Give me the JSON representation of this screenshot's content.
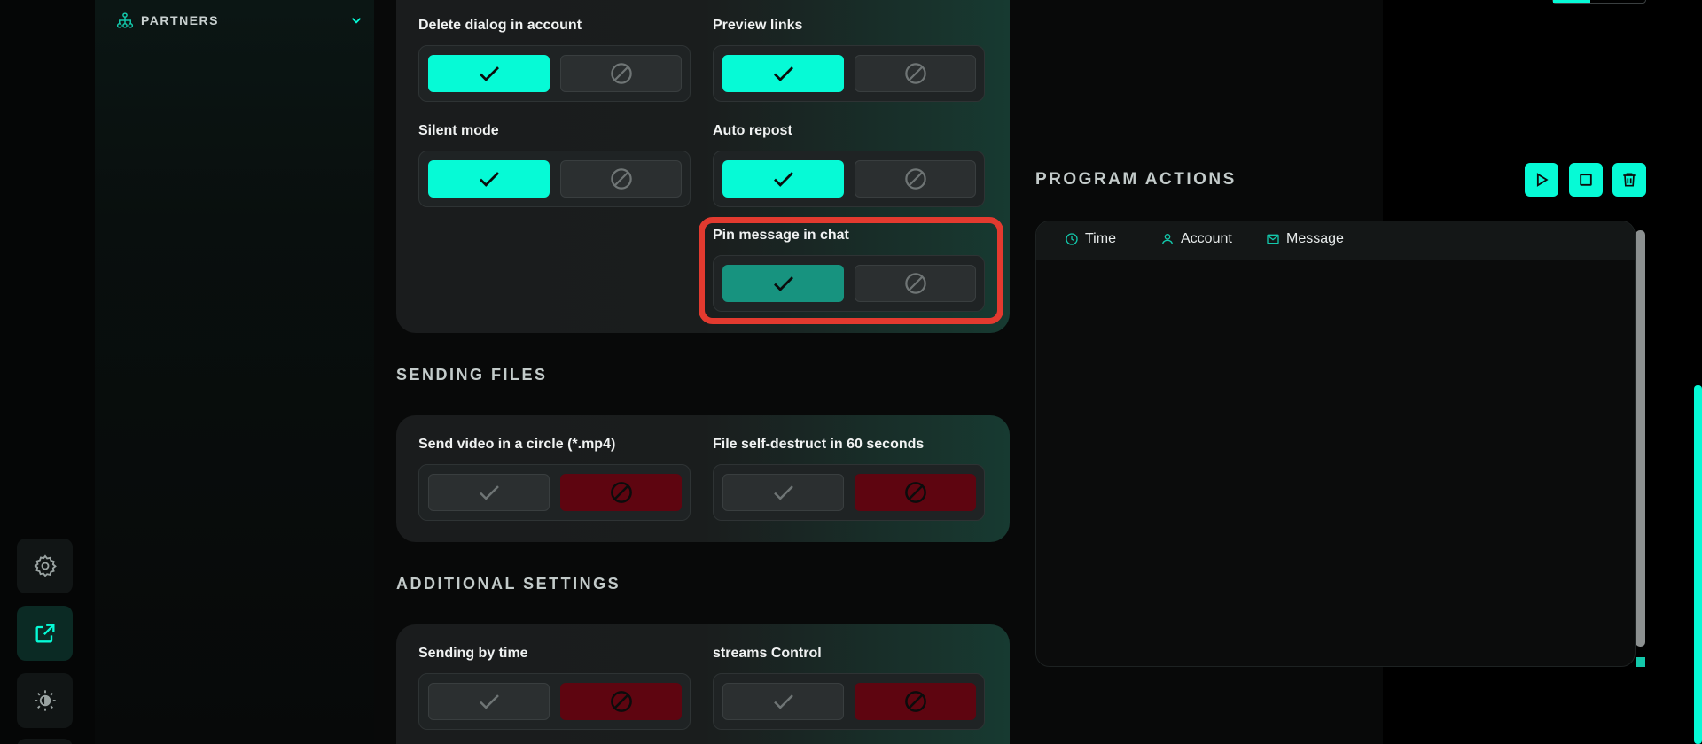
{
  "sidebar": {
    "partners_label": "PARTNERS"
  },
  "rail": {
    "icons": [
      "gear-icon",
      "external-link-icon",
      "theme-toggle-icon"
    ]
  },
  "sections": {
    "sending_files_title": "SENDING FILES",
    "additional_settings_title": "ADDITIONAL SETTINGS"
  },
  "options": {
    "delete_dialog": {
      "label": "Delete dialog in account",
      "enabled": true
    },
    "preview_links": {
      "label": "Preview links",
      "enabled": true
    },
    "silent_mode": {
      "label": "Silent mode",
      "enabled": true
    },
    "auto_repost": {
      "label": "Auto repost",
      "enabled": true
    },
    "pin_message": {
      "label": "Pin message in chat",
      "enabled": true
    },
    "send_video_circle": {
      "label": "Send video in a circle (*.mp4)",
      "enabled": false
    },
    "file_self_destruct": {
      "label": "File self-destruct in 60 seconds",
      "enabled": false
    },
    "sending_by_time": {
      "label": "Sending by time",
      "enabled": false
    },
    "streams_control": {
      "label": "streams Control",
      "enabled": false
    }
  },
  "program_actions": {
    "title": "PROGRAM ACTIONS",
    "columns": [
      "Time",
      "Account",
      "Message"
    ]
  },
  "colors": {
    "accent": "#06fad6",
    "disabled_active": "#5e0510",
    "highlight": "#e23a2f"
  }
}
